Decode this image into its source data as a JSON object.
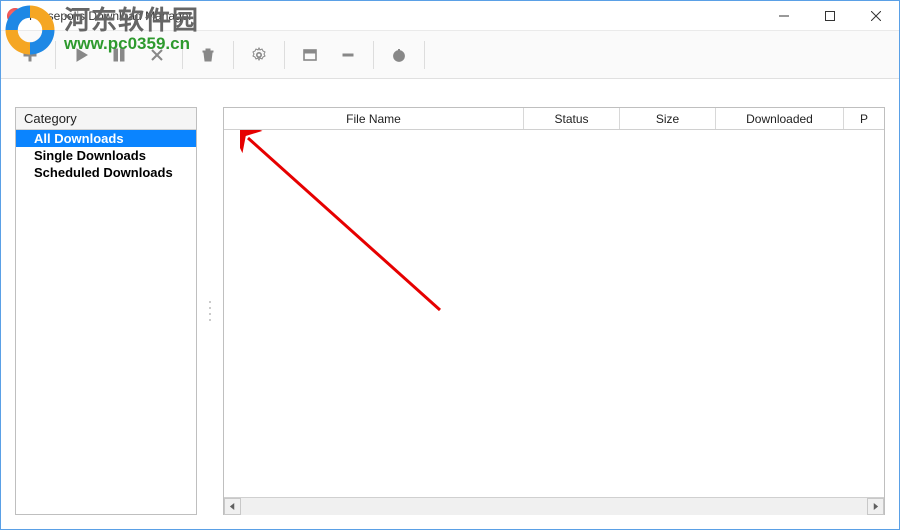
{
  "window": {
    "title": "Persepolis Download Manager"
  },
  "sidebar": {
    "header": "Category",
    "items": [
      {
        "label": "All Downloads",
        "selected": true
      },
      {
        "label": "Single Downloads",
        "selected": false
      },
      {
        "label": "Scheduled Downloads",
        "selected": false
      }
    ]
  },
  "table": {
    "columns": [
      {
        "label": "File Name",
        "key": "filename"
      },
      {
        "label": "Status",
        "key": "status"
      },
      {
        "label": "Size",
        "key": "size"
      },
      {
        "label": "Downloaded",
        "key": "downloaded"
      },
      {
        "label": "P",
        "key": "last"
      }
    ],
    "rows": []
  },
  "toolbar": {
    "buttons": [
      {
        "name": "add",
        "icon": "plus-icon"
      },
      {
        "name": "resume",
        "icon": "play-icon"
      },
      {
        "name": "pause",
        "icon": "pause-icon"
      },
      {
        "name": "stop",
        "icon": "close-icon"
      },
      {
        "name": "remove",
        "icon": "trash-icon"
      },
      {
        "name": "settings",
        "icon": "gear-icon"
      },
      {
        "name": "queue",
        "icon": "window-icon"
      },
      {
        "name": "minimize-to-tray",
        "icon": "minus-icon"
      },
      {
        "name": "power",
        "icon": "power-icon"
      }
    ]
  },
  "watermark": {
    "site_name_cn": "河东软件园",
    "site_url": "www.pc0359.cn"
  }
}
